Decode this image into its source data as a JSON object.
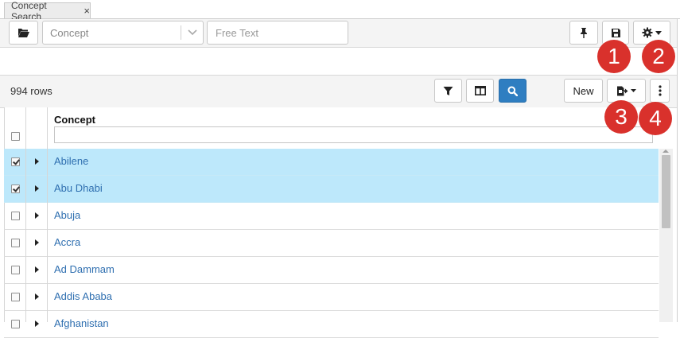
{
  "tab": {
    "label": "Concept Search",
    "close": "×"
  },
  "search": {
    "concept_value": "Concept",
    "free_text_placeholder": "Free Text"
  },
  "grid": {
    "row_count": "994 rows",
    "new_label": "New",
    "column_header": "Concept",
    "rows": [
      {
        "label": "Abilene",
        "checked": true,
        "selected": true
      },
      {
        "label": "Abu Dhabi",
        "checked": true,
        "selected": true
      },
      {
        "label": "Abuja",
        "checked": false,
        "selected": false
      },
      {
        "label": "Accra",
        "checked": false,
        "selected": false
      },
      {
        "label": "Ad Dammam",
        "checked": false,
        "selected": false
      },
      {
        "label": "Addis Ababa",
        "checked": false,
        "selected": false
      },
      {
        "label": "Afghanistan",
        "checked": false,
        "selected": false
      }
    ]
  },
  "callouts": [
    "1",
    "2",
    "3",
    "4"
  ],
  "icons": {
    "open": "folder-open-icon",
    "pin": "pushpin-icon",
    "save": "floppy-disk-icon",
    "settings": "gear-icon",
    "filter": "funnel-icon",
    "columns": "columns-icon",
    "search": "search-icon",
    "export": "export-icon",
    "more": "vertical-ellipsis-icon"
  },
  "colors": {
    "selected_row": "#bde8fb",
    "link": "#2f6fb0",
    "primary_button": "#2f7ec1",
    "callout": "#d9312c"
  }
}
